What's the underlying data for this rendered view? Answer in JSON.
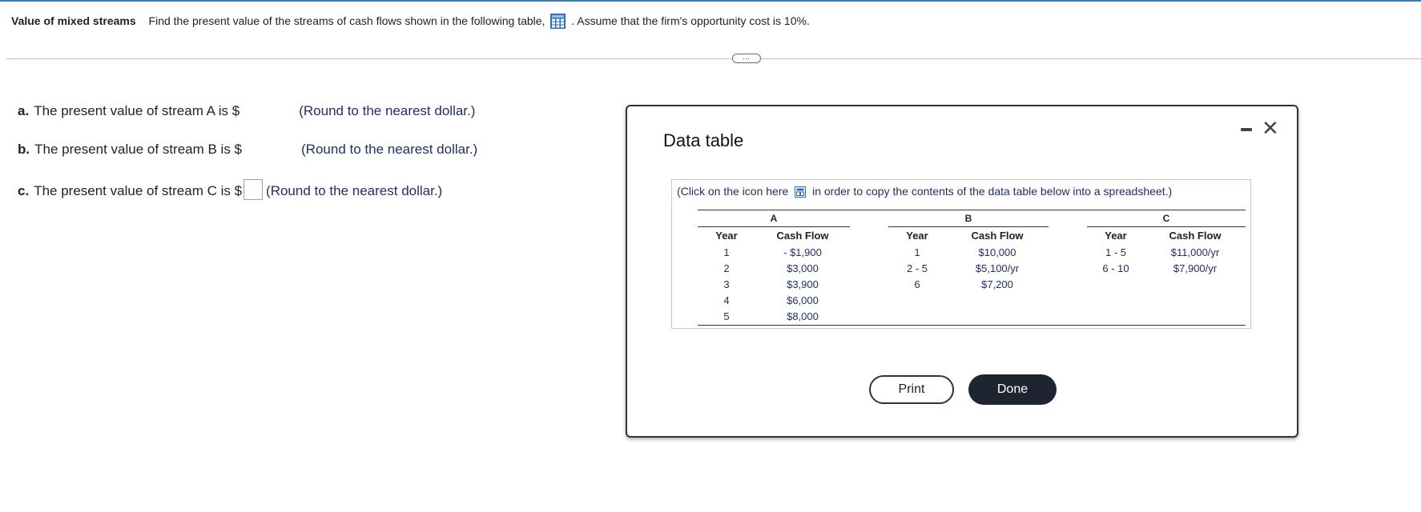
{
  "header": {
    "title": "Value of mixed streams",
    "text_before_icon": "Find the present value of the streams of cash flows shown in the following table,",
    "text_after_icon": ". Assume that the firm's opportunity cost is 10%."
  },
  "more_button_label": "…",
  "questions": [
    {
      "letter": "a.",
      "text": "The present value of stream A is $",
      "hint": "(Round to the nearest dollar.)"
    },
    {
      "letter": "b.",
      "text": "The present value of stream B is $",
      "hint": "(Round to the nearest dollar.)"
    },
    {
      "letter": "c.",
      "text": "The present value of stream C is $",
      "hint": "(Round to the nearest dollar.)"
    }
  ],
  "modal": {
    "title": "Data table",
    "instruction_before": "(Click on the icon here",
    "instruction_after": "in order to copy the contents of the data table below into a spreadsheet.)",
    "print_label": "Print",
    "done_label": "Done",
    "table": {
      "groups": [
        "A",
        "B",
        "C"
      ],
      "col_year": "Year",
      "col_cash": "Cash Flow",
      "rows": [
        {
          "a_year": "1",
          "a_cf": "- $1,900",
          "b_year": "1",
          "b_cf": "$10,000",
          "c_year": "1 - 5",
          "c_cf": "$11,000/yr"
        },
        {
          "a_year": "2",
          "a_cf": "$3,000",
          "b_year": "2 - 5",
          "b_cf": "$5,100/yr",
          "c_year": "6 - 10",
          "c_cf": "$7,900/yr"
        },
        {
          "a_year": "3",
          "a_cf": "$3,900",
          "b_year": "6",
          "b_cf": "$7,200",
          "c_year": "",
          "c_cf": ""
        },
        {
          "a_year": "4",
          "a_cf": "$6,000",
          "b_year": "",
          "b_cf": "",
          "c_year": "",
          "c_cf": ""
        },
        {
          "a_year": "5",
          "a_cf": "$8,000",
          "b_year": "",
          "b_cf": "",
          "c_year": "",
          "c_cf": ""
        }
      ]
    }
  }
}
